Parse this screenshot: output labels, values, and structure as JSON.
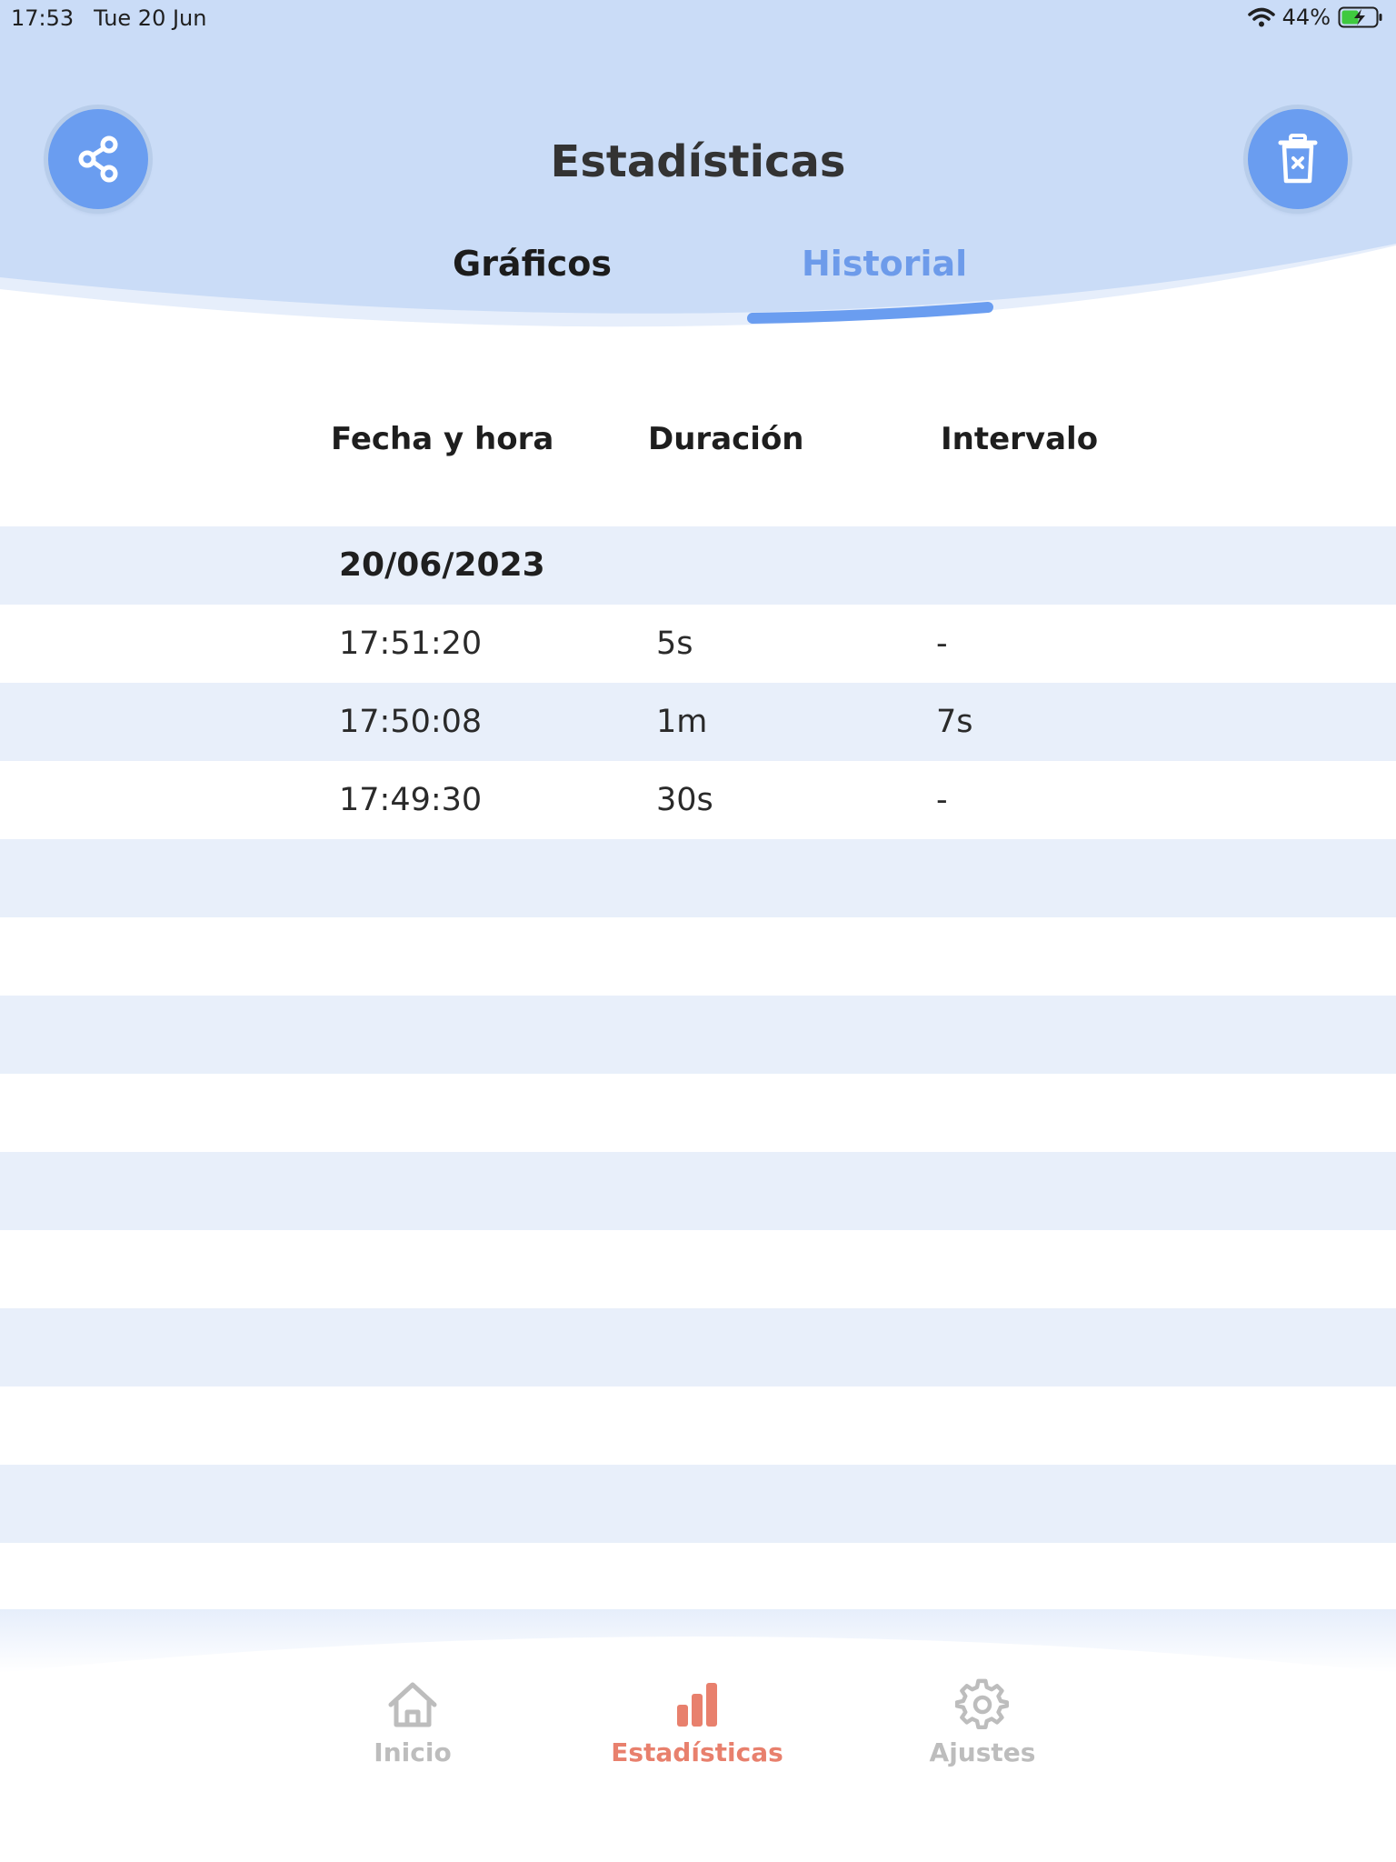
{
  "status_bar": {
    "time": "17:53",
    "date": "Tue 20 Jun",
    "battery": "44%"
  },
  "header": {
    "title": "Estadísticas",
    "share_icon": "share-icon",
    "trash_icon": "trash-icon"
  },
  "tabs": [
    {
      "label": "Gráficos",
      "active": false
    },
    {
      "label": "Historial",
      "active": true
    }
  ],
  "table": {
    "columns": [
      "Fecha y hora",
      "Duración",
      "Intervalo"
    ],
    "date_group": "20/06/2023",
    "rows": [
      {
        "time": "17:51:20",
        "duration": "5s",
        "interval": "-"
      },
      {
        "time": "17:50:08",
        "duration": "1m",
        "interval": "7s"
      },
      {
        "time": "17:49:30",
        "duration": "30s",
        "interval": "-"
      }
    ]
  },
  "nav": [
    {
      "label": "Inicio",
      "icon": "home-icon",
      "active": false
    },
    {
      "label": "Estadísticas",
      "icon": "bar-chart-icon",
      "active": true
    },
    {
      "label": "Ajustes",
      "icon": "gear-icon",
      "active": false
    }
  ],
  "colors": {
    "header_bg": "#cadcf7",
    "accent_blue": "#6a9df0",
    "row_alt": "#e8effa",
    "active_nav": "#e8806d",
    "inactive_nav": "#bdbdbd"
  }
}
